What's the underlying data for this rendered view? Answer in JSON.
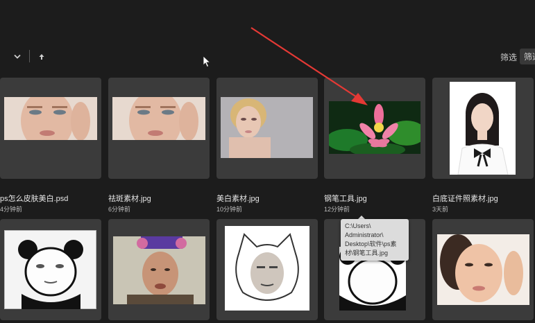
{
  "toolbar": {
    "filter_tab_1": "筛选",
    "filter_tab_2": "筛选"
  },
  "files": [
    {
      "name": "ps怎么皮肤美白.psd",
      "time": "4分钟前",
      "thumb": "portrait-woman-hands-face"
    },
    {
      "name": "祛斑素材.jpg",
      "time": "6分钟前",
      "thumb": "portrait-woman-hands-face"
    },
    {
      "name": "美白素材.jpg",
      "time": "10分钟前",
      "thumb": "portrait-blonde-woman"
    },
    {
      "name": "钢笔工具.jpg",
      "time": "12分钟前",
      "thumb": "lotus-flower"
    },
    {
      "name": "白底证件照素材.jpg",
      "time": "3天前",
      "thumb": "id-photo-woman"
    },
    {
      "name": "",
      "time": "",
      "thumb": "panda-meme"
    },
    {
      "name": "",
      "time": "",
      "thumb": "costume-woman"
    },
    {
      "name": "",
      "time": "",
      "thumb": "cat-face-meme"
    },
    {
      "name": "",
      "time": "",
      "thumb": "panda-meme-2"
    },
    {
      "name": "",
      "time": "",
      "thumb": "portrait-woman-skin"
    }
  ],
  "tooltip": {
    "line1": "C:\\Users\\",
    "line2": "Administrator\\",
    "line3": "Desktop\\软件\\ps素",
    "line4": "材\\钢笔工具.jpg"
  },
  "colors": {
    "background": "#1c1c1c",
    "card": "#3b3b3b",
    "arrow": "#e53935"
  }
}
